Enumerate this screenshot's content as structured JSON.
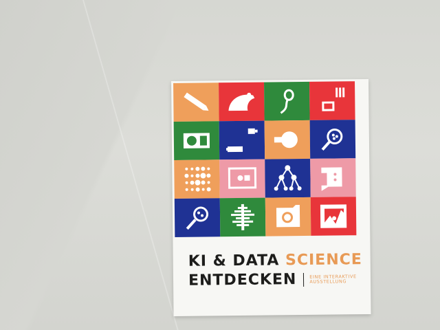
{
  "card": {
    "title_part1": "KI & DATA",
    "title_accent": "SCIENCE",
    "title_line2": "ENTDECKEN",
    "subtitle": "EINE INTERAKTIVE AUSSTELLUNG"
  },
  "colors": {
    "orange": "#ef9f5b",
    "red": "#e8353a",
    "green": "#2f8a3c",
    "blue": "#1f3294",
    "pink": "#ee9aa7",
    "accent_text": "#e89a55",
    "dark_text": "#1d1d1b"
  },
  "tiles": [
    {
      "icon": "pencil-icon",
      "color": "orange"
    },
    {
      "icon": "mouse-icon",
      "color": "red"
    },
    {
      "icon": "sperm-icon",
      "color": "green"
    },
    {
      "icon": "image-chart-icon",
      "color": "red"
    },
    {
      "icon": "radio-icon",
      "color": "green"
    },
    {
      "icon": "usb-stick-icon",
      "color": "blue"
    },
    {
      "icon": "lightbulb-icon",
      "color": "orange"
    },
    {
      "icon": "magnifier-icon",
      "color": "blue"
    },
    {
      "icon": "dot-matrix-icon",
      "color": "orange"
    },
    {
      "icon": "picture-frame-icon",
      "color": "pink"
    },
    {
      "icon": "network-tree-icon",
      "color": "blue"
    },
    {
      "icon": "speech-bubble-icon",
      "color": "pink"
    },
    {
      "icon": "magnifier-cells-icon",
      "color": "blue"
    },
    {
      "icon": "christmas-tree-icon",
      "color": "green"
    },
    {
      "icon": "camera-icon",
      "color": "orange"
    },
    {
      "icon": "broken-image-icon",
      "color": "red"
    }
  ]
}
